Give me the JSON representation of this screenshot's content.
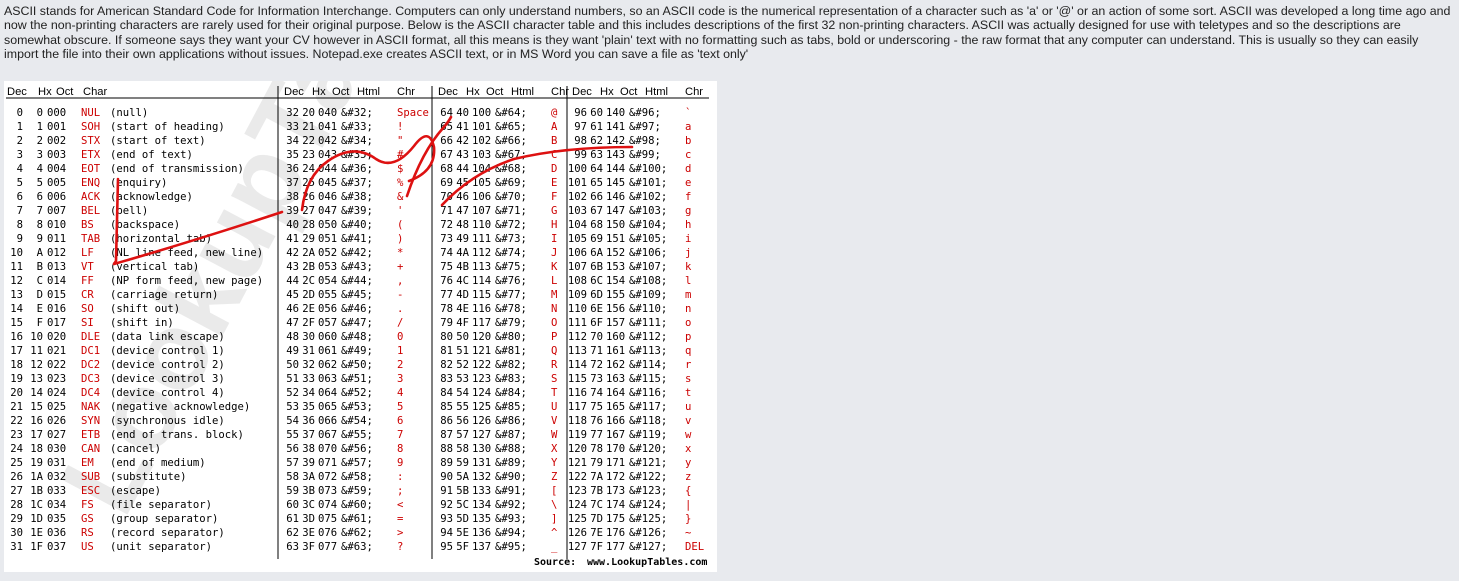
{
  "intro_text": "ASCII stands for American Standard Code for Information Interchange. Computers can only understand numbers, so an ASCII code is the numerical representation of a character such as 'a' or '@' or an action of some sort. ASCII was developed a long time ago and now the non-printing characters are rarely used for their original purpose. Below is the ASCII character table and this includes descriptions of the first 32 non-printing characters. ASCII was actually designed for use with teletypes and so the descriptions are somewhat obscure. If someone says they want your CV however in ASCII format, all this means is they want 'plain' text with no formatting such as tabs, bold or underscoring - the raw format that any computer can understand. This is usually so they can easily import the file into their own applications without issues. Notepad.exe creates ASCII text, or in MS Word you can save a file as 'text only'",
  "table": {
    "headers_ctrl": [
      "Dec",
      "Hx",
      "Oct",
      "Char"
    ],
    "headers_print": [
      "Dec",
      "Hx",
      "Oct",
      "Html",
      "Chr"
    ],
    "control": [
      [
        "0",
        "0",
        "000",
        "NUL",
        "(null)"
      ],
      [
        "1",
        "1",
        "001",
        "SOH",
        "(start of heading)"
      ],
      [
        "2",
        "2",
        "002",
        "STX",
        "(start of text)"
      ],
      [
        "3",
        "3",
        "003",
        "ETX",
        "(end of text)"
      ],
      [
        "4",
        "4",
        "004",
        "EOT",
        "(end of transmission)"
      ],
      [
        "5",
        "5",
        "005",
        "ENQ",
        "(enquiry)"
      ],
      [
        "6",
        "6",
        "006",
        "ACK",
        "(acknowledge)"
      ],
      [
        "7",
        "7",
        "007",
        "BEL",
        "(bell)"
      ],
      [
        "8",
        "8",
        "010",
        "BS",
        "(backspace)"
      ],
      [
        "9",
        "9",
        "011",
        "TAB",
        "(horizontal tab)"
      ],
      [
        "10",
        "A",
        "012",
        "LF",
        "(NL line feed, new line)"
      ],
      [
        "11",
        "B",
        "013",
        "VT",
        "(vertical tab)"
      ],
      [
        "12",
        "C",
        "014",
        "FF",
        "(NP form feed, new page)"
      ],
      [
        "13",
        "D",
        "015",
        "CR",
        "(carriage return)"
      ],
      [
        "14",
        "E",
        "016",
        "SO",
        "(shift out)"
      ],
      [
        "15",
        "F",
        "017",
        "SI",
        "(shift in)"
      ],
      [
        "16",
        "10",
        "020",
        "DLE",
        "(data link escape)"
      ],
      [
        "17",
        "11",
        "021",
        "DC1",
        "(device control 1)"
      ],
      [
        "18",
        "12",
        "022",
        "DC2",
        "(device control 2)"
      ],
      [
        "19",
        "13",
        "023",
        "DC3",
        "(device control 3)"
      ],
      [
        "20",
        "14",
        "024",
        "DC4",
        "(device control 4)"
      ],
      [
        "21",
        "15",
        "025",
        "NAK",
        "(negative acknowledge)"
      ],
      [
        "22",
        "16",
        "026",
        "SYN",
        "(synchronous idle)"
      ],
      [
        "23",
        "17",
        "027",
        "ETB",
        "(end of trans. block)"
      ],
      [
        "24",
        "18",
        "030",
        "CAN",
        "(cancel)"
      ],
      [
        "25",
        "19",
        "031",
        "EM",
        "(end of medium)"
      ],
      [
        "26",
        "1A",
        "032",
        "SUB",
        "(substitute)"
      ],
      [
        "27",
        "1B",
        "033",
        "ESC",
        "(escape)"
      ],
      [
        "28",
        "1C",
        "034",
        "FS",
        "(file separator)"
      ],
      [
        "29",
        "1D",
        "035",
        "GS",
        "(group separator)"
      ],
      [
        "30",
        "1E",
        "036",
        "RS",
        "(record separator)"
      ],
      [
        "31",
        "1F",
        "037",
        "US",
        "(unit separator)"
      ]
    ],
    "col2": [
      [
        "32",
        "20",
        "040",
        "&#32;",
        "Space"
      ],
      [
        "33",
        "21",
        "041",
        "&#33;",
        "!"
      ],
      [
        "34",
        "22",
        "042",
        "&#34;",
        "\""
      ],
      [
        "35",
        "23",
        "043",
        "&#35;",
        "#"
      ],
      [
        "36",
        "24",
        "044",
        "&#36;",
        "$"
      ],
      [
        "37",
        "25",
        "045",
        "&#37;",
        "%"
      ],
      [
        "38",
        "26",
        "046",
        "&#38;",
        "&"
      ],
      [
        "39",
        "27",
        "047",
        "&#39;",
        "'"
      ],
      [
        "40",
        "28",
        "050",
        "&#40;",
        "("
      ],
      [
        "41",
        "29",
        "051",
        "&#41;",
        ")"
      ],
      [
        "42",
        "2A",
        "052",
        "&#42;",
        "*"
      ],
      [
        "43",
        "2B",
        "053",
        "&#43;",
        "+"
      ],
      [
        "44",
        "2C",
        "054",
        "&#44;",
        ","
      ],
      [
        "45",
        "2D",
        "055",
        "&#45;",
        "-"
      ],
      [
        "46",
        "2E",
        "056",
        "&#46;",
        "."
      ],
      [
        "47",
        "2F",
        "057",
        "&#47;",
        "/"
      ],
      [
        "48",
        "30",
        "060",
        "&#48;",
        "0"
      ],
      [
        "49",
        "31",
        "061",
        "&#49;",
        "1"
      ],
      [
        "50",
        "32",
        "062",
        "&#50;",
        "2"
      ],
      [
        "51",
        "33",
        "063",
        "&#51;",
        "3"
      ],
      [
        "52",
        "34",
        "064",
        "&#52;",
        "4"
      ],
      [
        "53",
        "35",
        "065",
        "&#53;",
        "5"
      ],
      [
        "54",
        "36",
        "066",
        "&#54;",
        "6"
      ],
      [
        "55",
        "37",
        "067",
        "&#55;",
        "7"
      ],
      [
        "56",
        "38",
        "070",
        "&#56;",
        "8"
      ],
      [
        "57",
        "39",
        "071",
        "&#57;",
        "9"
      ],
      [
        "58",
        "3A",
        "072",
        "&#58;",
        ":"
      ],
      [
        "59",
        "3B",
        "073",
        "&#59;",
        ";"
      ],
      [
        "60",
        "3C",
        "074",
        "&#60;",
        "<"
      ],
      [
        "61",
        "3D",
        "075",
        "&#61;",
        "="
      ],
      [
        "62",
        "3E",
        "076",
        "&#62;",
        ">"
      ],
      [
        "63",
        "3F",
        "077",
        "&#63;",
        "?"
      ]
    ],
    "col3": [
      [
        "64",
        "40",
        "100",
        "&#64;",
        "@"
      ],
      [
        "65",
        "41",
        "101",
        "&#65;",
        "A"
      ],
      [
        "66",
        "42",
        "102",
        "&#66;",
        "B"
      ],
      [
        "67",
        "43",
        "103",
        "&#67;",
        "C"
      ],
      [
        "68",
        "44",
        "104",
        "&#68;",
        "D"
      ],
      [
        "69",
        "45",
        "105",
        "&#69;",
        "E"
      ],
      [
        "70",
        "46",
        "106",
        "&#70;",
        "F"
      ],
      [
        "71",
        "47",
        "107",
        "&#71;",
        "G"
      ],
      [
        "72",
        "48",
        "110",
        "&#72;",
        "H"
      ],
      [
        "73",
        "49",
        "111",
        "&#73;",
        "I"
      ],
      [
        "74",
        "4A",
        "112",
        "&#74;",
        "J"
      ],
      [
        "75",
        "4B",
        "113",
        "&#75;",
        "K"
      ],
      [
        "76",
        "4C",
        "114",
        "&#76;",
        "L"
      ],
      [
        "77",
        "4D",
        "115",
        "&#77;",
        "M"
      ],
      [
        "78",
        "4E",
        "116",
        "&#78;",
        "N"
      ],
      [
        "79",
        "4F",
        "117",
        "&#79;",
        "O"
      ],
      [
        "80",
        "50",
        "120",
        "&#80;",
        "P"
      ],
      [
        "81",
        "51",
        "121",
        "&#81;",
        "Q"
      ],
      [
        "82",
        "52",
        "122",
        "&#82;",
        "R"
      ],
      [
        "83",
        "53",
        "123",
        "&#83;",
        "S"
      ],
      [
        "84",
        "54",
        "124",
        "&#84;",
        "T"
      ],
      [
        "85",
        "55",
        "125",
        "&#85;",
        "U"
      ],
      [
        "86",
        "56",
        "126",
        "&#86;",
        "V"
      ],
      [
        "87",
        "57",
        "127",
        "&#87;",
        "W"
      ],
      [
        "88",
        "58",
        "130",
        "&#88;",
        "X"
      ],
      [
        "89",
        "59",
        "131",
        "&#89;",
        "Y"
      ],
      [
        "90",
        "5A",
        "132",
        "&#90;",
        "Z"
      ],
      [
        "91",
        "5B",
        "133",
        "&#91;",
        "["
      ],
      [
        "92",
        "5C",
        "134",
        "&#92;",
        "\\"
      ],
      [
        "93",
        "5D",
        "135",
        "&#93;",
        "]"
      ],
      [
        "94",
        "5E",
        "136",
        "&#94;",
        "^"
      ],
      [
        "95",
        "5F",
        "137",
        "&#95;",
        "_"
      ]
    ],
    "col4": [
      [
        "96",
        "60",
        "140",
        "&#96;",
        "`"
      ],
      [
        "97",
        "61",
        "141",
        "&#97;",
        "a"
      ],
      [
        "98",
        "62",
        "142",
        "&#98;",
        "b"
      ],
      [
        "99",
        "63",
        "143",
        "&#99;",
        "c"
      ],
      [
        "100",
        "64",
        "144",
        "&#100;",
        "d"
      ],
      [
        "101",
        "65",
        "145",
        "&#101;",
        "e"
      ],
      [
        "102",
        "66",
        "146",
        "&#102;",
        "f"
      ],
      [
        "103",
        "67",
        "147",
        "&#103;",
        "g"
      ],
      [
        "104",
        "68",
        "150",
        "&#104;",
        "h"
      ],
      [
        "105",
        "69",
        "151",
        "&#105;",
        "i"
      ],
      [
        "106",
        "6A",
        "152",
        "&#106;",
        "j"
      ],
      [
        "107",
        "6B",
        "153",
        "&#107;",
        "k"
      ],
      [
        "108",
        "6C",
        "154",
        "&#108;",
        "l"
      ],
      [
        "109",
        "6D",
        "155",
        "&#109;",
        "m"
      ],
      [
        "110",
        "6E",
        "156",
        "&#110;",
        "n"
      ],
      [
        "111",
        "6F",
        "157",
        "&#111;",
        "o"
      ],
      [
        "112",
        "70",
        "160",
        "&#112;",
        "p"
      ],
      [
        "113",
        "71",
        "161",
        "&#113;",
        "q"
      ],
      [
        "114",
        "72",
        "162",
        "&#114;",
        "r"
      ],
      [
        "115",
        "73",
        "163",
        "&#115;",
        "s"
      ],
      [
        "116",
        "74",
        "164",
        "&#116;",
        "t"
      ],
      [
        "117",
        "75",
        "165",
        "&#117;",
        "u"
      ],
      [
        "118",
        "76",
        "166",
        "&#118;",
        "v"
      ],
      [
        "119",
        "77",
        "167",
        "&#119;",
        "w"
      ],
      [
        "120",
        "78",
        "170",
        "&#120;",
        "x"
      ],
      [
        "121",
        "79",
        "171",
        "&#121;",
        "y"
      ],
      [
        "122",
        "7A",
        "172",
        "&#122;",
        "z"
      ],
      [
        "123",
        "7B",
        "173",
        "&#123;",
        "{"
      ],
      [
        "124",
        "7C",
        "174",
        "&#124;",
        "|"
      ],
      [
        "125",
        "7D",
        "175",
        "&#125;",
        "}"
      ],
      [
        "126",
        "7E",
        "176",
        "&#126;",
        "~"
      ],
      [
        "127",
        "7F",
        "177",
        "&#127;",
        "DEL"
      ]
    ],
    "watermark": "LookupTables",
    "source_label": "Source:",
    "source_url": "www.LookupTables.com"
  },
  "colors": {
    "accent_red": "#cc0000",
    "annotation_red": "#dd1111",
    "page_bg": "#e8eaee"
  }
}
